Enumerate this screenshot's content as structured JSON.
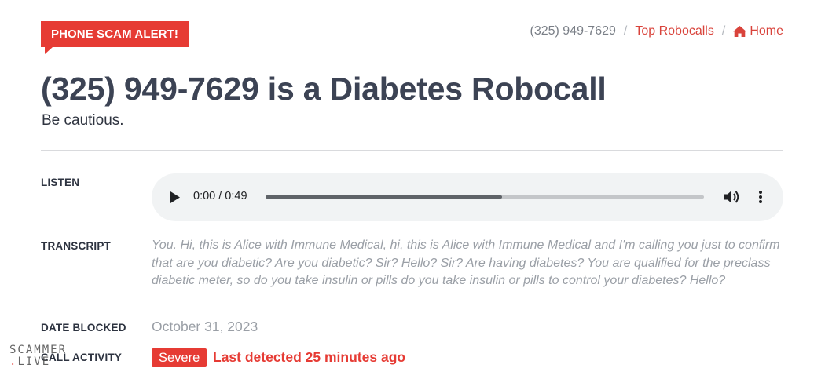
{
  "alert": {
    "label": "PHONE SCAM ALERT!"
  },
  "breadcrumb": {
    "current": "(325) 949-7629",
    "separator": "/",
    "top_robocalls": "Top Robocalls",
    "home": "Home"
  },
  "header": {
    "number": "(325) 949-7629",
    "title_rest": " is a Diabetes Robocall",
    "subtitle": "Be cautious."
  },
  "fields": {
    "listen_label": "LISTEN",
    "transcript_label": "TRANSCRIPT",
    "date_label": "DATE BLOCKED",
    "activity_label": "CALL ACTIVITY"
  },
  "audio": {
    "time": "0:00 / 0:49",
    "progress": 0.54,
    "play_icon": "play-icon",
    "volume_icon": "volume-icon",
    "more_icon": "more-vert-icon"
  },
  "transcript": "You. Hi, this is Alice with Immune Medical, hi, this is Alice with Immune Medical and I'm calling you just to confirm that are you diabetic? Are you diabetic? Sir? Hello? Sir? Are having diabetes? You are qualified for the preclass diabetic meter, so do you take insulin or pills do you take insulin or pills to control your diabetes? Hello?",
  "date_blocked": "October 31, 2023",
  "activity": {
    "severity": "Severe",
    "detected": "Last detected 25 minutes ago"
  },
  "watermark": {
    "line1": "SCAMMER",
    "line2_dot": ".",
    "line2": "LIVE"
  },
  "colors": {
    "accent": "#e63b34",
    "text": "#3a4150",
    "muted": "#9a9fa6"
  }
}
